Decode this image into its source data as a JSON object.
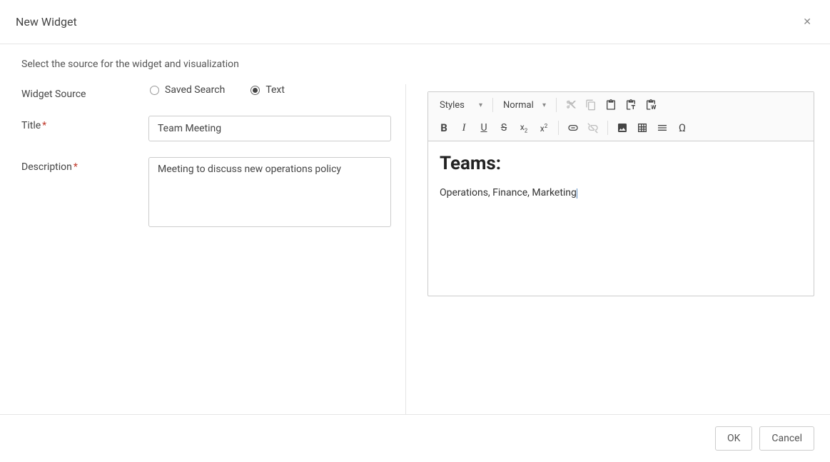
{
  "dialog": {
    "title": "New Widget",
    "instruction": "Select the source for the widget and visualization",
    "close_symbol": "✕"
  },
  "form": {
    "widget_source_label": "Widget Source",
    "options": {
      "saved_search": {
        "label": "Saved Search",
        "selected": false
      },
      "text": {
        "label": "Text",
        "selected": true
      }
    },
    "title_label": "Title",
    "title_value": "Team Meeting",
    "description_label": "Description",
    "description_value": "Meeting to discuss new operations policy"
  },
  "editor": {
    "toolbar": {
      "styles_label": "Styles",
      "format_label": "Normal"
    },
    "content": {
      "heading": "Teams:",
      "paragraph": "Operations, Finance, Marketing"
    }
  },
  "footer": {
    "ok_label": "OK",
    "cancel_label": "Cancel"
  }
}
